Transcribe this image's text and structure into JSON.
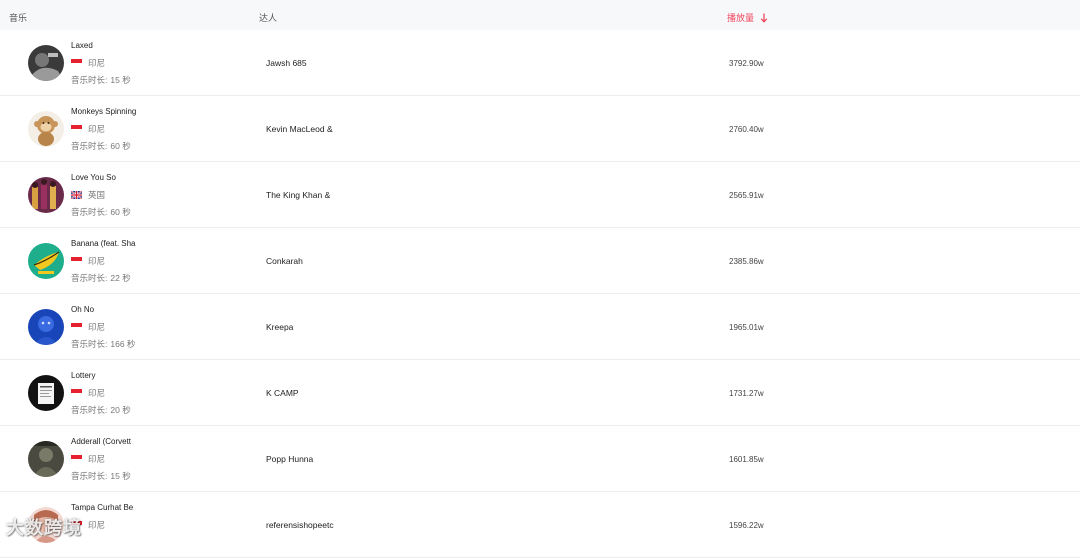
{
  "header": {
    "music_label": "音乐",
    "talent_label": "达人",
    "plays_label": "播放量"
  },
  "duration_label": "音乐时长:",
  "rows": [
    {
      "title": "Laxed",
      "country": "印尼",
      "flag": "indonesia",
      "duration": "15 秒",
      "talent": "Jawsh 685",
      "plays": "3792.90w"
    },
    {
      "title": "Monkeys Spinning",
      "country": "印尼",
      "flag": "indonesia",
      "duration": "60 秒",
      "talent": "Kevin MacLeod &",
      "plays": "2760.40w"
    },
    {
      "title": "Love You So",
      "country": "英国",
      "flag": "uk",
      "duration": "60 秒",
      "talent": "The King Khan &",
      "plays": "2565.91w"
    },
    {
      "title": "Banana (feat. Sha",
      "country": "印尼",
      "flag": "indonesia",
      "duration": "22 秒",
      "talent": "Conkarah",
      "plays": "2385.86w"
    },
    {
      "title": "Oh No",
      "country": "印尼",
      "flag": "indonesia",
      "duration": "166 秒",
      "talent": "Kreepa",
      "plays": "1965.01w"
    },
    {
      "title": "Lottery",
      "country": "印尼",
      "flag": "indonesia",
      "duration": "20 秒",
      "talent": "K CAMP",
      "plays": "1731.27w"
    },
    {
      "title": "Adderall (Corvett",
      "country": "印尼",
      "flag": "indonesia",
      "duration": "15 秒",
      "talent": "Popp Hunna",
      "plays": "1601.85w"
    },
    {
      "title": "Tampa Curhat Be",
      "country": "印尼",
      "flag": "indonesia",
      "duration": "",
      "talent": "referensishopeetc",
      "plays": "1596.22w"
    }
  ],
  "watermark": "大数跨境",
  "colors": {
    "accent": "#f0475e",
    "header_bg": "#f7f8fa",
    "divider": "#ececec"
  }
}
